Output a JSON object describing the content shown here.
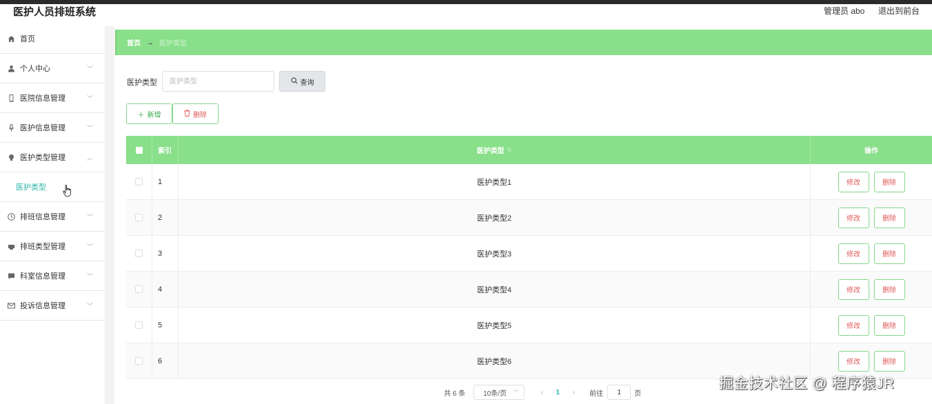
{
  "header": {
    "title": "医护人员排班系统",
    "user": "管理员 abo",
    "logout": "退出到前台"
  },
  "sidebar": {
    "items": [
      {
        "label": "首页",
        "icon": "home-icon"
      },
      {
        "label": "个人中心",
        "icon": "user-icon"
      },
      {
        "label": "医院信息管理",
        "icon": "mobile-icon"
      },
      {
        "label": "医护信息管理",
        "icon": "microphone-icon"
      },
      {
        "label": "医护类型管理",
        "icon": "lightbulb-icon"
      },
      {
        "label": "排班信息管理",
        "icon": "clock-icon"
      },
      {
        "label": "排班类型管理",
        "icon": "printer-icon"
      },
      {
        "label": "科室信息管理",
        "icon": "message-icon"
      },
      {
        "label": "投诉信息管理",
        "icon": "mail-icon"
      }
    ],
    "submenu_label": "医护类型"
  },
  "breadcrumb": {
    "home": "首页",
    "arrow": "→",
    "current": "医护类型"
  },
  "search": {
    "label": "医护类型",
    "placeholder": "医护类型",
    "button": "查询"
  },
  "actions": {
    "add": "新增",
    "delete": "删除"
  },
  "table": {
    "headers": {
      "index": "索引",
      "type": "医护类型",
      "ops": "操作"
    },
    "rows": [
      {
        "index": "1",
        "type": "医护类型1"
      },
      {
        "index": "2",
        "type": "医护类型2"
      },
      {
        "index": "3",
        "type": "医护类型3"
      },
      {
        "index": "4",
        "type": "医护类型4"
      },
      {
        "index": "5",
        "type": "医护类型5"
      },
      {
        "index": "6",
        "type": "医护类型6"
      }
    ],
    "edit_label": "修改",
    "delete_label": "删除"
  },
  "pagination": {
    "total": "共 6 条",
    "page_size": "10条/页",
    "current_page": "1",
    "goto_label": "前往",
    "goto_value": "1",
    "page_suffix": "页"
  },
  "watermark": "掘金技术社区 @ 程序猿JR",
  "colors": {
    "accent_green": "#89df8a",
    "teal": "#2bb6a8",
    "danger_red": "#e05a5a"
  }
}
